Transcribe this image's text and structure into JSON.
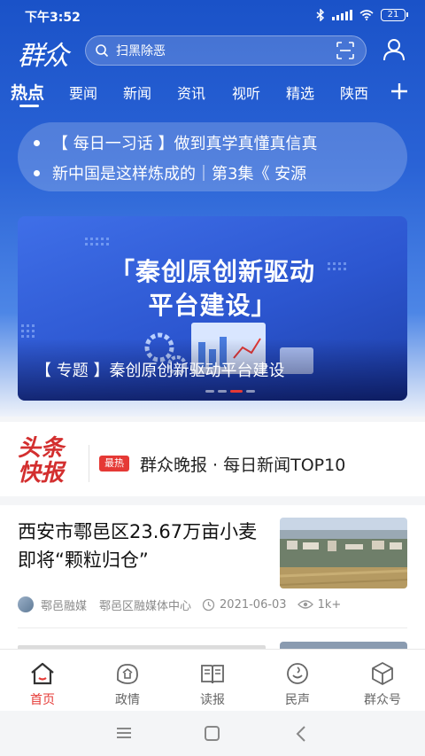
{
  "status_bar": {
    "time": "下午3:52",
    "battery": "21"
  },
  "header": {
    "logo_text": "群众",
    "search_placeholder": "扫黑除恶"
  },
  "tabs": [
    {
      "label": "热点",
      "active": true
    },
    {
      "label": "要闻"
    },
    {
      "label": "新闻"
    },
    {
      "label": "资讯"
    },
    {
      "label": "视听"
    },
    {
      "label": "精选"
    },
    {
      "label": "陕西"
    }
  ],
  "ticker": [
    "【 每日一习话 】做到真学真懂真信真",
    "新中国是这样炼成的｜第3集《 安源"
  ],
  "banner": {
    "title_line1": "「秦创原创新驱动",
    "title_line2": "平台建设」",
    "caption": "【 专题 】秦创原创新驱动平台建设",
    "slide_count": 4,
    "active_slide": 3
  },
  "headline": {
    "logo_line1": "头条",
    "logo_line2": "快报",
    "badge": "最热",
    "text": "群众晚报 · 每日新闻TOP10"
  },
  "article": {
    "title": "西安市鄠邑区23.67万亩小麦即将“颗粒归仓”",
    "source": "鄠邑融媒",
    "org": "鄠邑区融媒体中心",
    "date": "2021-06-03",
    "views": "1k+"
  },
  "bottom_nav": [
    {
      "label": "首页",
      "icon": "home-icon",
      "active": true
    },
    {
      "label": "政情",
      "icon": "politics-icon"
    },
    {
      "label": "读报",
      "icon": "newspaper-icon"
    },
    {
      "label": "民声",
      "icon": "voice-icon"
    },
    {
      "label": "群众号",
      "icon": "cube-icon"
    }
  ],
  "colors": {
    "primary_blue": "#2a63d6",
    "accent_red": "#e53935"
  }
}
